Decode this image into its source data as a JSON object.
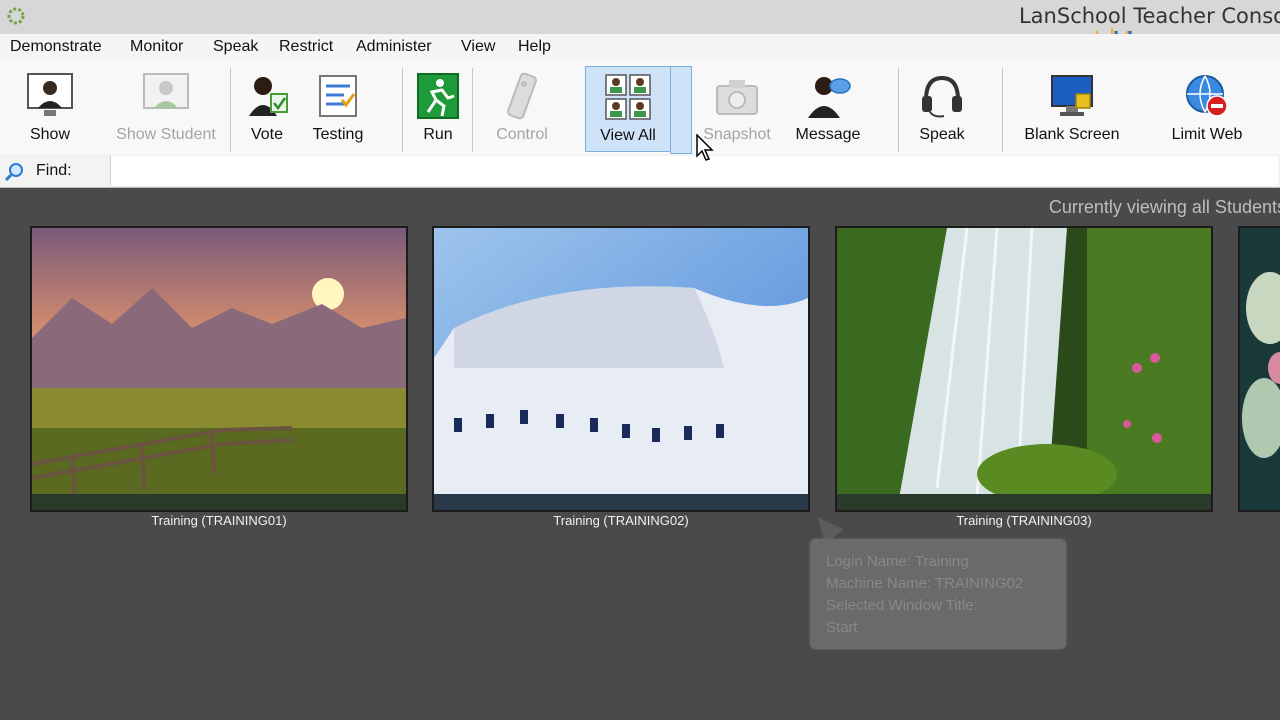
{
  "window": {
    "title": "LanSchool Teacher Conso",
    "brand_logo_text": "ligra"
  },
  "menu": [
    "Demonstrate",
    "Monitor",
    "Speak",
    "Restrict",
    "Administer",
    "View",
    "Help"
  ],
  "toolbar": {
    "show": "Show",
    "show_student": "Show Student",
    "vote": "Vote",
    "testing": "Testing",
    "run": "Run",
    "control": "Control",
    "view_all": "View All",
    "snapshot": "Snapshot",
    "message": "Message",
    "speak": "Speak",
    "blank_screen": "Blank Screen",
    "limit_web": "Limit Web"
  },
  "find": {
    "label": "Find:",
    "value": ""
  },
  "status": "Currently viewing all Students",
  "students": [
    {
      "label": "Training (TRAINING01)"
    },
    {
      "label": "Training (TRAINING02)"
    },
    {
      "label": "Training (TRAINING03)"
    }
  ],
  "tooltip": {
    "lines": [
      "Login Name: Training",
      "Machine Name: TRAINING02",
      "Selected Window Title:",
      "Start"
    ]
  },
  "colors": {
    "content_bg": "#4a4a4a",
    "active_tool_bg": "#cfe3f8",
    "brand_blue": "#1e6fb0",
    "brand_orange": "#f5a623"
  }
}
